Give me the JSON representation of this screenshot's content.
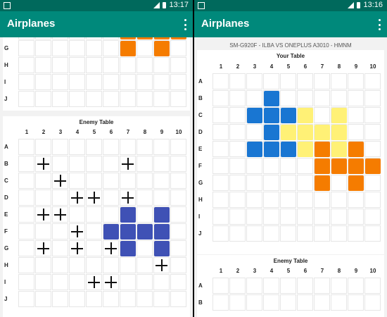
{
  "colors": {
    "status_bar": "#00695c",
    "app_bar": "#00897b",
    "plane_blue": "#1976d2",
    "plane_yellow": "#fff176",
    "plane_orange": "#f57c00",
    "enemy_hit_blue": "#3f51b5"
  },
  "status": {
    "left_time": "13:17",
    "right_time": "13:16",
    "notification_icon": "screenshot-icon",
    "signal_icon": "signal-icon",
    "battery_icon": "battery-icon"
  },
  "columns": [
    "1",
    "2",
    "3",
    "4",
    "5",
    "6",
    "7",
    "8",
    "9",
    "10"
  ],
  "rows": [
    "A",
    "B",
    "C",
    "D",
    "E",
    "F",
    "G",
    "H",
    "I",
    "J"
  ],
  "left": {
    "app_title": "Airplanes",
    "menu_icon": "more-vert-icon",
    "top_table_visible_rows": [
      "G",
      "H",
      "I",
      "J"
    ],
    "top_table_orange_cells": [
      [
        "F",
        7
      ],
      [
        "F",
        8
      ],
      [
        "F",
        9
      ],
      [
        "F",
        10
      ],
      [
        "G",
        7
      ],
      [
        "G",
        9
      ]
    ],
    "enemy_table_title": "Enemy Table",
    "enemy_blue_cells": [
      [
        "E",
        7
      ],
      [
        "E",
        9
      ],
      [
        "F",
        6
      ],
      [
        "F",
        7
      ],
      [
        "F",
        8
      ],
      [
        "F",
        9
      ],
      [
        "G",
        7
      ],
      [
        "G",
        9
      ]
    ],
    "enemy_crosses": [
      [
        "B",
        2
      ],
      [
        "B",
        7
      ],
      [
        "C",
        3
      ],
      [
        "D",
        4
      ],
      [
        "D",
        5
      ],
      [
        "D",
        7
      ],
      [
        "E",
        2
      ],
      [
        "E",
        3
      ],
      [
        "F",
        4
      ],
      [
        "G",
        2
      ],
      [
        "G",
        4
      ],
      [
        "G",
        6
      ],
      [
        "H",
        9
      ],
      [
        "I",
        5
      ],
      [
        "I",
        6
      ]
    ]
  },
  "right": {
    "app_title": "Airplanes",
    "menu_icon": "more-vert-icon",
    "match_header": "SM-G920F - ILBA VS ONEPLUS A3010 - HMNM",
    "your_table_title": "Your Table",
    "blue_cells": [
      [
        "B",
        4
      ],
      [
        "C",
        3
      ],
      [
        "C",
        4
      ],
      [
        "C",
        5
      ],
      [
        "D",
        4
      ],
      [
        "E",
        3
      ],
      [
        "E",
        4
      ],
      [
        "E",
        5
      ]
    ],
    "yellow_cells": [
      [
        "C",
        6
      ],
      [
        "C",
        8
      ],
      [
        "D",
        5
      ],
      [
        "D",
        6
      ],
      [
        "D",
        7
      ],
      [
        "D",
        8
      ],
      [
        "E",
        6
      ],
      [
        "E",
        8
      ]
    ],
    "orange_cells": [
      [
        "E",
        7
      ],
      [
        "E",
        9
      ],
      [
        "F",
        7
      ],
      [
        "F",
        8
      ],
      [
        "F",
        9
      ],
      [
        "F",
        10
      ],
      [
        "G",
        7
      ],
      [
        "G",
        9
      ]
    ],
    "enemy_table_title": "Enemy Table",
    "enemy_visible_rows": [
      "A",
      "B"
    ]
  }
}
